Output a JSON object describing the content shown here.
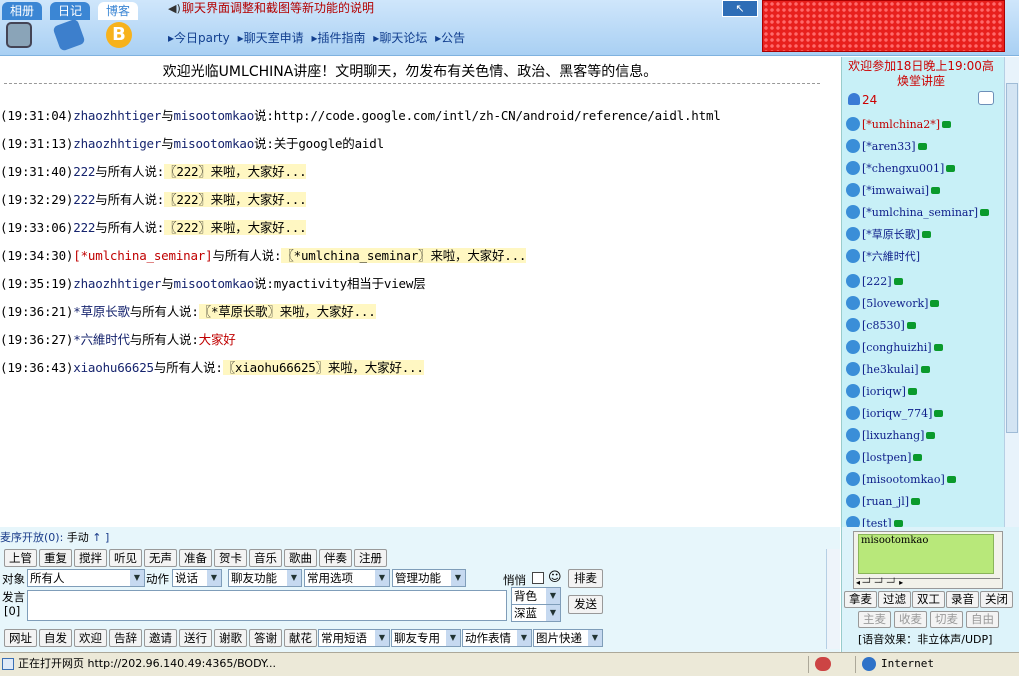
{
  "topbar": {
    "tabs": [
      "相册",
      "日记",
      "博客"
    ],
    "notice": "聊天界面调整和截图等新功能的说明",
    "nav_links": [
      "▸今日party",
      "▸聊天室申请",
      "▸插件指南",
      "▸聊天论坛",
      "▸公告"
    ]
  },
  "chat": {
    "welcome": "欢迎光临UMLCHINA讲座！文明聊天，勿发布有关色情、政治、黑客等的信息。",
    "messages": [
      {
        "time": "(19:31:04)",
        "speaker": "zhaozhhtiger",
        "mid": "与",
        "target": "misootomkao",
        "said": "说:",
        "text": "http://code.google.com/intl/zh-CN/android/reference/aidl.html"
      },
      {
        "time": "(19:31:13)",
        "speaker": "zhaozhhtiger",
        "mid": "与",
        "target": "misootomkao",
        "said": "说:",
        "text": "关于google的aidl"
      },
      {
        "time": "(19:31:40)",
        "speaker": "222",
        "mid": "与",
        "target": "所有人",
        "said": "说:",
        "text": "〖222〗来啦，大家好..."
      },
      {
        "time": "(19:32:29)",
        "speaker": "222",
        "mid": "与",
        "target": "所有人",
        "said": "说:",
        "text": "〖222〗来啦，大家好..."
      },
      {
        "time": "(19:33:06)",
        "speaker": "222",
        "mid": "与",
        "target": "所有人",
        "said": "说:",
        "text": "〖222〗来啦，大家好..."
      },
      {
        "time": "(19:34:30)",
        "speaker": "[*umlchina_seminar]",
        "mid": "与",
        "target": "所有人",
        "said": "说:",
        "text": "〖*umlchina_seminar〗来啦，大家好..."
      },
      {
        "time": "(19:35:19)",
        "speaker": "zhaozhhtiger",
        "mid": "与",
        "target": "misootomkao",
        "said": "说:",
        "text": "myactivity相当于view层"
      },
      {
        "time": "(19:36:21)",
        "speaker": "*草原长歌",
        "mid": "与",
        "target": "所有人",
        "said": "说:",
        "text": "〖*草原长歌〗来啦，大家好..."
      },
      {
        "time": "(19:36:27)",
        "speaker": "*六維时代",
        "mid": "与",
        "target": "所有人",
        "said": "说:",
        "text": "大家好"
      },
      {
        "time": "(19:36:43)",
        "speaker": "xiaohu66625",
        "mid": "与",
        "target": "所有人",
        "said": "说:",
        "text": "〖xiaohu66625〗来啦，大家好..."
      }
    ]
  },
  "right_panel": {
    "title": "欢迎参加18日晚上19:00高焕堂讲座",
    "online_count": "24",
    "users": [
      "[*umlchina2*]",
      "[*aren33]",
      "[*chengxu001]",
      "[*imwaiwai]",
      "[*umlchina_seminar]",
      "[*草原长歌]",
      "[*六維时代]",
      "[222]",
      "[5lovework]",
      "[c8530]",
      "[conghuizhi]",
      "[he3kulai]",
      "[ioriqw]",
      "[ioriqw_774]",
      "[lixuzhang]",
      "[lostpen]",
      "[misootomkao]",
      "[ruan_jl]",
      "[test]"
    ]
  },
  "bottom": {
    "queue_label": "麦序开放",
    "queue_count": "(0):",
    "queue_mode": "手动",
    "queue_arrow": "↑",
    "queue_end": "]",
    "row1_buttons": [
      "上管",
      "重复",
      "搅拌",
      "听见",
      "无声",
      "准备",
      "贺卡",
      "音乐",
      "歌曲",
      "伴奏",
      "注册"
    ],
    "target_label": "对象",
    "target_value": "所有人",
    "action_label": "动作",
    "action_value": "说话",
    "friend_func": "聊友功能",
    "common_options": "常用选项",
    "admin_func": "管理功能",
    "whisper_label": "悄悄",
    "smiley": "☺",
    "queue_button": "排麦",
    "speak_label": "发言",
    "speak_count": "[0]",
    "bg_color": "背色",
    "deep_blue": "深蓝",
    "send_button": "发送",
    "row3_buttons": [
      "网址",
      "自发",
      "欢迎",
      "告辞",
      "邀请",
      "送行",
      "谢歌",
      "答谢",
      "献花"
    ],
    "common_phrases": "常用短语",
    "friend_special": "聊友专用",
    "action_expr": "动作表情",
    "pic_express": "图片快递"
  },
  "voice": {
    "name": "misootomkao",
    "buttons_row1": [
      "拿麦",
      "过滤",
      "双工",
      "录音",
      "关闭"
    ],
    "buttons_row2": [
      "主麦",
      "收麦",
      "切麦",
      "自由"
    ],
    "effect": "[语音效果：非立体声/UDP]"
  },
  "statusbar": {
    "text": "正在打开网页 http://202.96.140.49:4365/BODY...",
    "zone": "Internet"
  }
}
